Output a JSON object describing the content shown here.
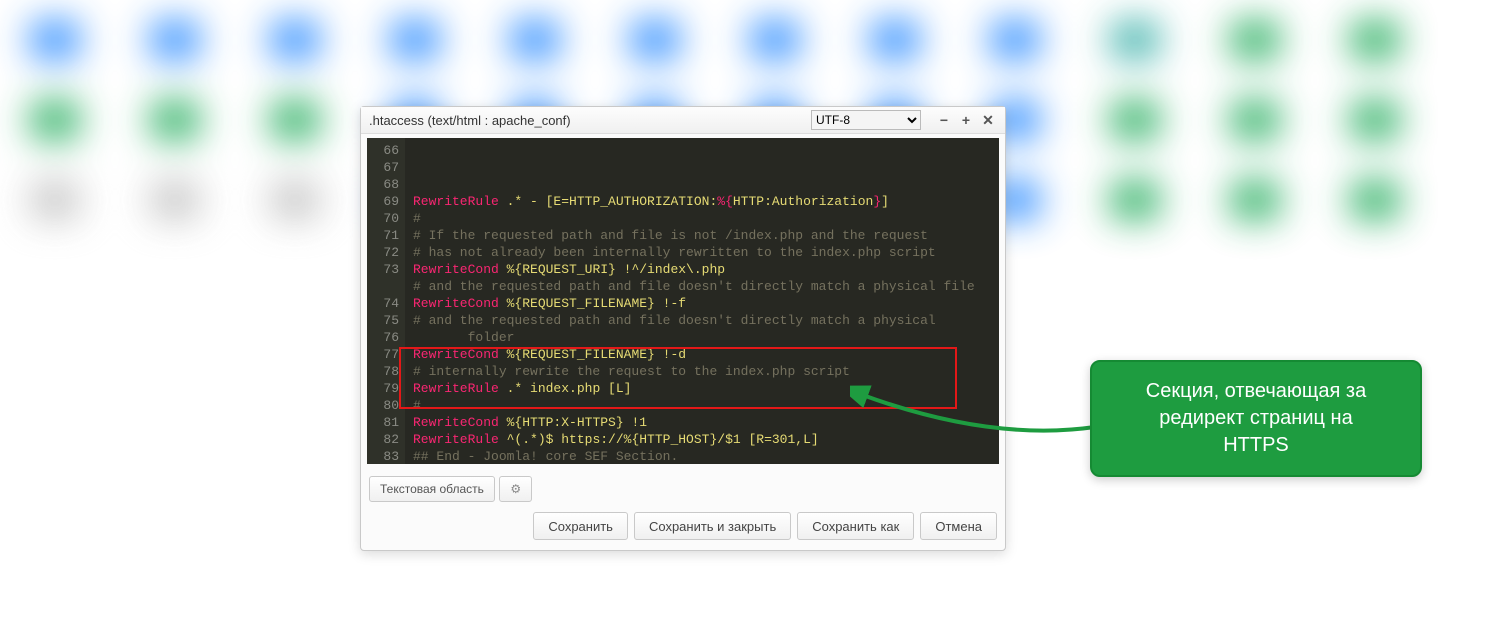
{
  "window": {
    "title": ".htaccess (text/html : apache_conf)",
    "encoding": "UTF-8"
  },
  "lines": [
    {
      "n": 66,
      "seg": [
        [
          "kw",
          "RewriteRule"
        ],
        [
          "str",
          " .* - [E=HTTP_AUTHORIZATION:"
        ],
        [
          "kw",
          "%{"
        ],
        [
          "str",
          "HTTP:Authorization"
        ],
        [
          "kw",
          "}"
        ],
        [
          "str",
          "]"
        ]
      ]
    },
    {
      "n": 67,
      "seg": [
        [
          "cmt",
          "#"
        ]
      ]
    },
    {
      "n": 68,
      "seg": [
        [
          "cmt",
          "# If the requested path and file is not /index.php and the request"
        ]
      ]
    },
    {
      "n": 69,
      "seg": [
        [
          "cmt",
          "# has not already been internally rewritten to the index.php script"
        ]
      ]
    },
    {
      "n": 70,
      "seg": [
        [
          "kw",
          "RewriteCond"
        ],
        [
          "str",
          " %{REQUEST_URI} !^/index\\.php"
        ]
      ]
    },
    {
      "n": 71,
      "seg": [
        [
          "cmt",
          "# and the requested path and file doesn't directly match a physical file"
        ]
      ]
    },
    {
      "n": 72,
      "seg": [
        [
          "kw",
          "RewriteCond"
        ],
        [
          "str",
          " %{REQUEST_FILENAME} !-f"
        ]
      ]
    },
    {
      "n": 73,
      "seg": [
        [
          "cmt",
          "# and the requested path and file doesn't directly match a physical\n       folder"
        ]
      ]
    },
    {
      "n": 74,
      "seg": [
        [
          "kw",
          "RewriteCond"
        ],
        [
          "str",
          " %{REQUEST_FILENAME} !-d"
        ]
      ]
    },
    {
      "n": 75,
      "seg": [
        [
          "cmt",
          "# internally rewrite the request to the index.php script"
        ]
      ]
    },
    {
      "n": 76,
      "seg": [
        [
          "kw",
          "RewriteRule"
        ],
        [
          "str",
          " .* index.php [L]"
        ]
      ]
    },
    {
      "n": 77,
      "seg": [
        [
          "cmt",
          "#"
        ]
      ]
    },
    {
      "n": 78,
      "seg": [
        [
          "kw",
          "RewriteCond"
        ],
        [
          "str",
          " %{HTTP:X-HTTPS} !1"
        ]
      ]
    },
    {
      "n": 79,
      "seg": [
        [
          "kw",
          "RewriteRule"
        ],
        [
          "str",
          " ^(.*)$ https://%{HTTP_HOST}/$1 [R=301,L]"
        ]
      ]
    },
    {
      "n": 80,
      "seg": [
        [
          "cmt",
          "## End - Joomla! core SEF Section."
        ]
      ]
    },
    {
      "n": 81,
      "seg": [
        [
          "",
          ""
        ]
      ]
    },
    {
      "n": 82,
      "seg": [
        [
          "",
          ""
        ]
      ]
    },
    {
      "n": 83,
      "seg": [
        [
          "",
          ""
        ]
      ]
    }
  ],
  "toolbar": {
    "textarea": "Текстовая область"
  },
  "footer": {
    "save": "Сохранить",
    "save_close": "Сохранить и закрыть",
    "save_as": "Сохранить как",
    "cancel": "Отмена"
  },
  "callout": {
    "line1": "Секция, отвечающая за",
    "line2": "редирект страниц на",
    "line3": "HTTPS"
  }
}
